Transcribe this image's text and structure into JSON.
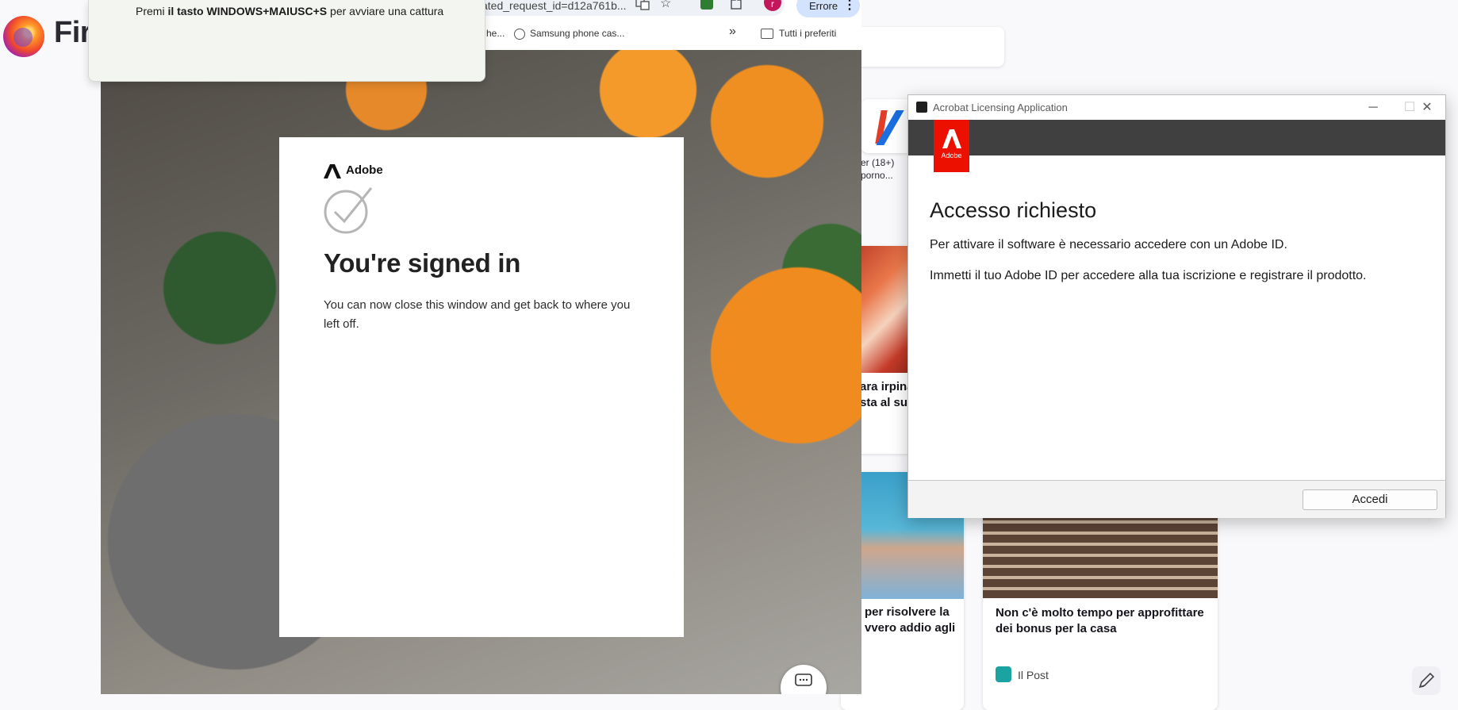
{
  "firefox": {
    "wordmark": "Fir",
    "tiles": [
      {
        "label_line1": "er (18+)",
        "label_line2": "porno..."
      }
    ],
    "stories": [
      {
        "title_line1": "ara irpina",
        "title_line2": "sta al sug"
      },
      {
        "title_line1": "per risolvere la",
        "title_line2": "vvero addio agli"
      },
      {
        "title_line1": "Non c'è molto tempo per approfittare",
        "title_line2": "dei bonus per la casa",
        "source": "Il Post"
      }
    ]
  },
  "chrome": {
    "url_fragment": "ated_request_id=d12a761b...",
    "profile_initial": "r",
    "error_button": "Errore",
    "bookmarks": [
      {
        "label": "he..."
      },
      {
        "label": "Samsung phone cas..."
      }
    ],
    "bookmarks_overflow": "»",
    "all_bookmarks": "Tutti i preferiti"
  },
  "signin": {
    "brand": "Adobe",
    "title": "You're signed in",
    "body": "You can now close this window and get back to where you left off."
  },
  "toast": {
    "prefix": "Premi ",
    "bold": "il tasto WINDOWS+MAIUSC+S",
    "suffix": " per avviare una cattura"
  },
  "dialog": {
    "window_title": "Acrobat Licensing Application",
    "logo_text": "Adobe",
    "heading": "Accesso richiesto",
    "paragraph1": "Per attivare il software è necessario accedere con un Adobe ID.",
    "paragraph2": "Immetti il tuo Adobe ID per accedere alla tua iscrizione e registrare il prodotto.",
    "primary_button": "Accedi"
  },
  "icons": [
    "firefox-logo-icon",
    "translate-icon",
    "star-icon",
    "extension-icon",
    "puzzle-icon",
    "more-vert-icon",
    "globe-icon",
    "folder-icon",
    "adobe-logo-icon",
    "check-circle-icon",
    "chat-icon",
    "pencil-icon",
    "minimize-icon",
    "maximize-icon",
    "close-icon"
  ],
  "colors": {
    "adobe_red": "#eb1000",
    "dialog_header": "#404040",
    "chrome_error_pill": "#d3e3fd"
  }
}
